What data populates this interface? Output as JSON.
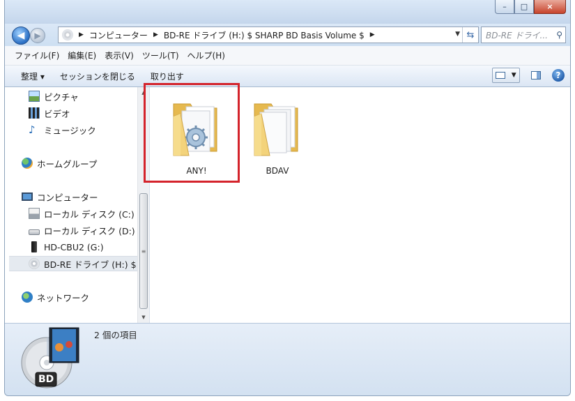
{
  "window": {
    "caption_buttons": [
      "–",
      "□",
      "×"
    ]
  },
  "address_bar": {
    "crumbs": [
      "コンピューター",
      "BD-RE ドライブ (H:) $ SHARP BD Basis Volume $"
    ],
    "search_placeholder": "BD-RE ドライ..."
  },
  "menu": [
    "ファイル(F)",
    "編集(E)",
    "表示(V)",
    "ツール(T)",
    "ヘルプ(H)"
  ],
  "toolbar": {
    "organize": "整理 ▾",
    "close_session": "セッションを閉じる",
    "eject": "取り出す"
  },
  "nav": {
    "pictures": "ピクチャ",
    "videos": "ビデオ",
    "music": "ミュージック",
    "homegroup": "ホームグループ",
    "computer": "コンピューター",
    "drive_c": "ローカル ディスク (C:)",
    "drive_d": "ローカル ディスク (D:)",
    "drive_g": "HD-CBU2 (G:)",
    "drive_h": "BD-RE ドライブ (H:) $",
    "network": "ネットワーク"
  },
  "files": [
    {
      "name": "ANY!"
    },
    {
      "name": "BDAV"
    }
  ],
  "details": {
    "count_text": "2 個の項目",
    "disc_label": "BD"
  },
  "colors": {
    "highlight": "#d4232b",
    "folder": "#f3d37b"
  }
}
